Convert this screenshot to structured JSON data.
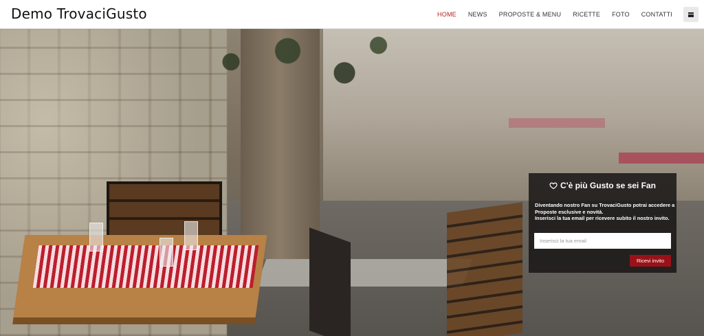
{
  "header": {
    "logo": "Demo TrovaciGusto",
    "nav": [
      {
        "label": "HOME",
        "active": true
      },
      {
        "label": "NEWS",
        "active": false
      },
      {
        "label": "PROPOSTE & MENU",
        "active": false
      },
      {
        "label": "RICETTE",
        "active": false
      },
      {
        "label": "FOTO",
        "active": false
      },
      {
        "label": "CONTATTI",
        "active": false
      }
    ],
    "menu_icon": "hamburger-icon"
  },
  "fanbox": {
    "icon": "heart-outline-icon",
    "title": "C'è più Gusto se sei Fan",
    "line1": "Diventando nostro Fan su TrovaciGusto potrai accedere a Proposte esclusive e novità.",
    "line2": "Inserisci la tua email per ricevere subito il nostro invito.",
    "email_placeholder": "Inserisci la tua email",
    "button_label": "Ricevi invito"
  },
  "colors": {
    "accent": "#b22222",
    "button": "#9b1118",
    "panel": "#181616"
  }
}
